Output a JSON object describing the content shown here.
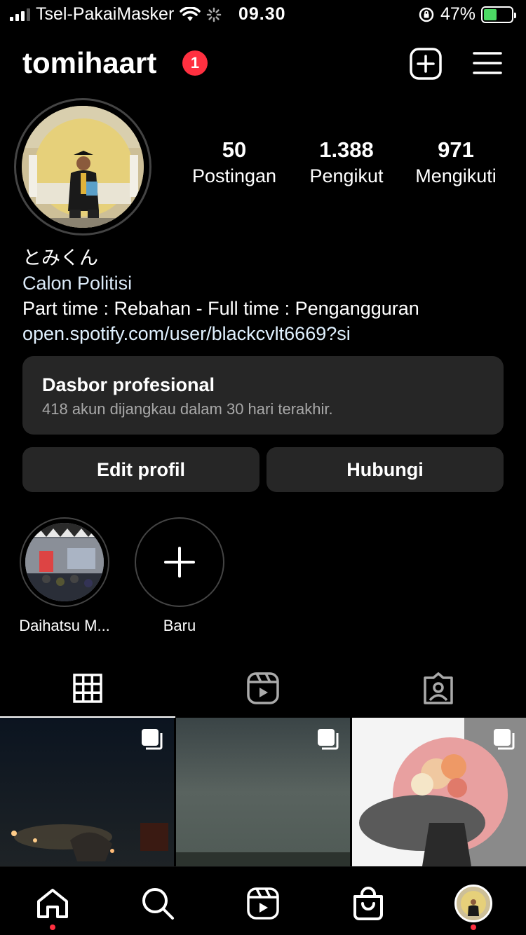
{
  "status_bar": {
    "carrier": "Tsel-PakaiMasker",
    "time": "09.30",
    "battery_percent": "47%",
    "battery_level": 0.47
  },
  "header": {
    "username": "tomihaart",
    "notification_count": "1",
    "create_icon": "plus-square-icon",
    "menu_icon": "hamburger-icon"
  },
  "profile": {
    "stats": [
      {
        "value": "50",
        "label": "Postingan"
      },
      {
        "value": "1.388",
        "label": "Pengikut"
      },
      {
        "value": "971",
        "label": "Mengikuti"
      }
    ],
    "name": "とみくん",
    "category": "Calon Politisi",
    "bio": "Part time : Rebahan - Full time : Pengangguran",
    "link": "open.spotify.com/user/blackcvlt6669?si"
  },
  "dashboard": {
    "title": "Dasbor profesional",
    "subtitle": "418 akun dijangkau dalam 30 hari terakhir."
  },
  "buttons": {
    "edit": "Edit profil",
    "contact": "Hubungi"
  },
  "highlights": [
    {
      "label": "Daihatsu M..."
    },
    {
      "label": "Baru"
    }
  ],
  "tabs": [
    {
      "icon": "grid-icon",
      "active": true
    },
    {
      "icon": "reels-icon",
      "active": false
    },
    {
      "icon": "tagged-icon",
      "active": false
    }
  ],
  "bottom_nav": [
    {
      "icon": "home-icon",
      "notification": true
    },
    {
      "icon": "search-icon",
      "notification": false
    },
    {
      "icon": "reels-icon",
      "notification": false
    },
    {
      "icon": "shop-icon",
      "notification": false
    },
    {
      "icon": "profile-avatar",
      "notification": true
    }
  ],
  "colors": {
    "background": "#000000",
    "surface": "#262626",
    "badge": "#ff3040",
    "battery": "#4cd964"
  }
}
